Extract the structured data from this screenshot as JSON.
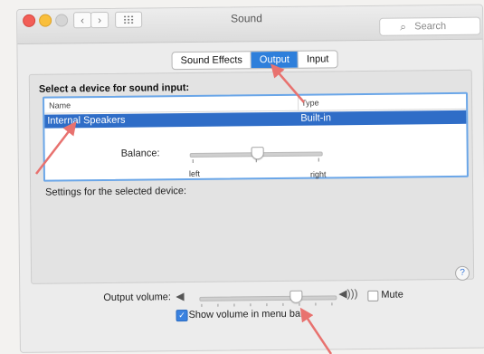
{
  "window": {
    "title": "Sound"
  },
  "search": {
    "placeholder": "Search"
  },
  "tabs": [
    {
      "label": "Sound Effects",
      "active": false
    },
    {
      "label": "Output",
      "active": true
    },
    {
      "label": "Input",
      "active": false
    }
  ],
  "device_panel": {
    "heading": "Select a device for sound input:",
    "columns": [
      "Name",
      "Type"
    ],
    "rows": [
      {
        "name": "Internal Speakers",
        "type": "Built-in",
        "selected": true
      }
    ]
  },
  "settings": {
    "label": "Settings for the selected device:",
    "balance_label": "Balance:",
    "balance_left": "left",
    "balance_right": "right",
    "balance_value": 0.48
  },
  "help": {
    "label": "?"
  },
  "output": {
    "volume_label": "Output volume:",
    "volume_value": 0.73,
    "mute_label": "Mute",
    "mute_checked": false,
    "show_volume_label": "Show volume in menu bar",
    "show_volume_checked": true
  },
  "colors": {
    "accent": "#2e7fdb",
    "selection": "#2f6dc7",
    "annotation_arrow": "#e8726f"
  }
}
